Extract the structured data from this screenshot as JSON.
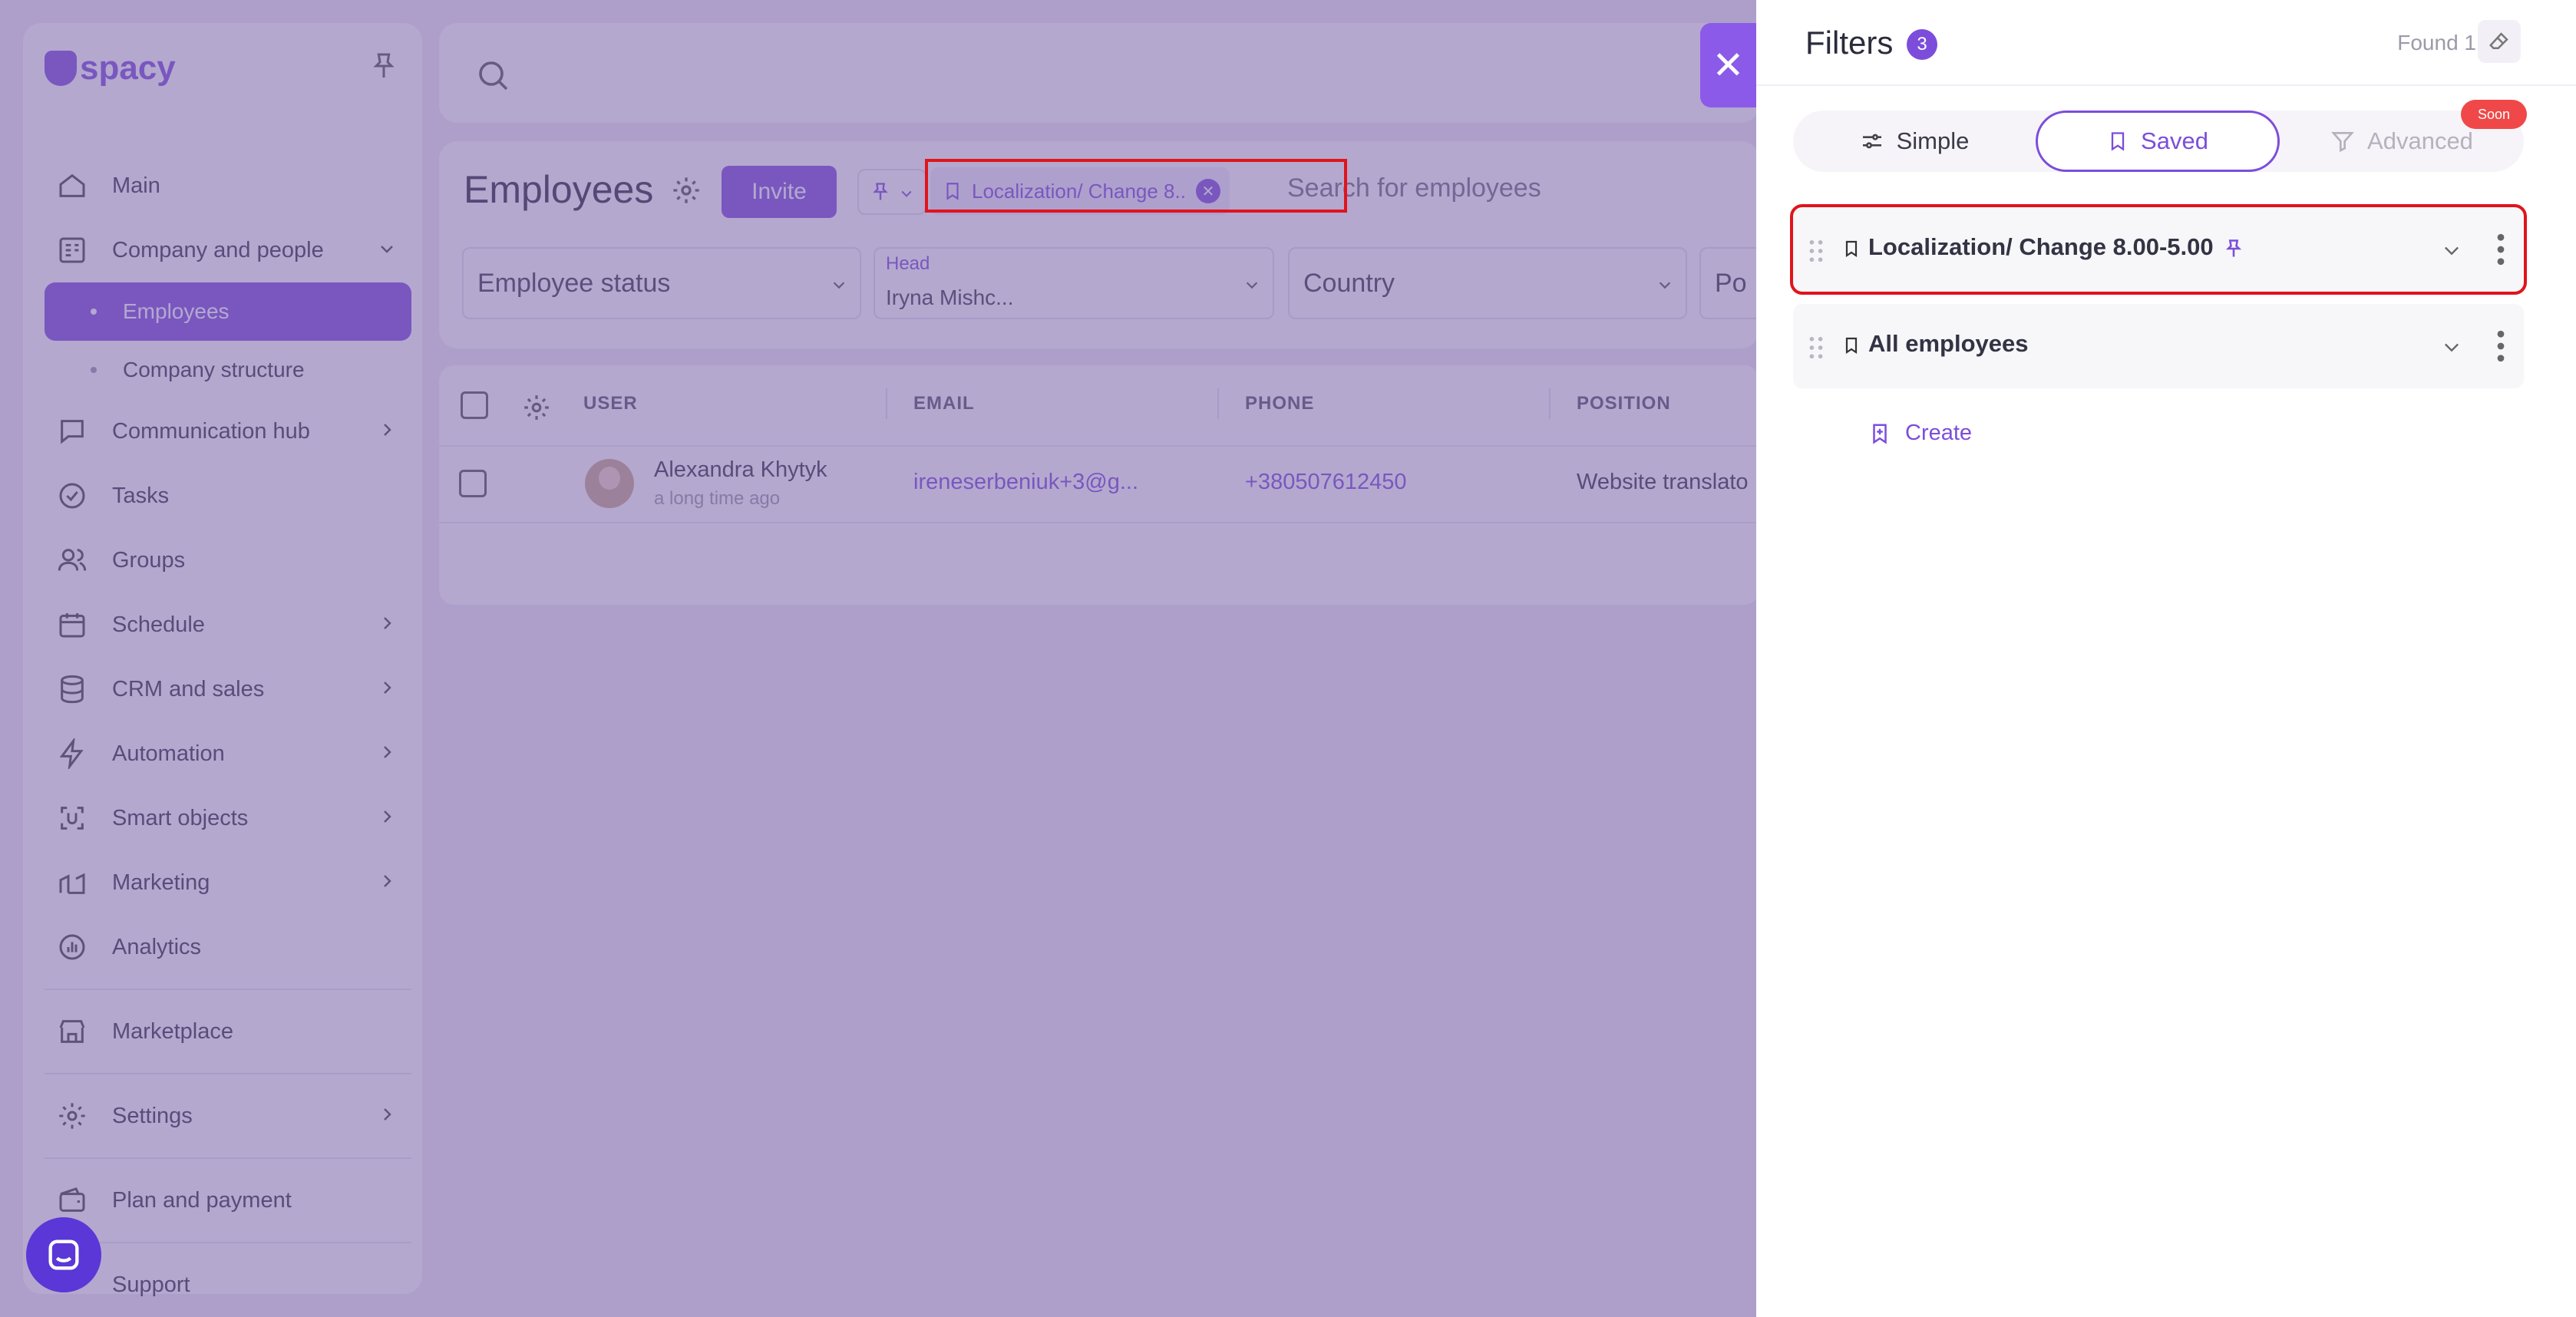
{
  "app": {
    "logo": "spacy"
  },
  "sidebar": {
    "items": [
      {
        "label": "Main",
        "icon": "home-icon"
      },
      {
        "label": "Company and people",
        "icon": "building-icon"
      },
      {
        "label": "Employees",
        "sub": true,
        "active": true
      },
      {
        "label": "Company structure",
        "sub": true
      },
      {
        "label": "Communication hub",
        "icon": "chat-icon"
      },
      {
        "label": "Tasks",
        "icon": "check-circle-icon"
      },
      {
        "label": "Groups",
        "icon": "users-icon"
      },
      {
        "label": "Schedule",
        "icon": "calendar-icon"
      },
      {
        "label": "CRM and sales",
        "icon": "database-icon"
      },
      {
        "label": "Automation",
        "icon": "bolt-icon"
      },
      {
        "label": "Smart objects",
        "icon": "smart-object-icon"
      },
      {
        "label": "Marketing",
        "icon": "marketing-icon"
      },
      {
        "label": "Analytics",
        "icon": "chart-icon"
      },
      {
        "label": "Marketplace",
        "icon": "store-icon"
      },
      {
        "label": "Settings",
        "icon": "gear-icon"
      },
      {
        "label": "Plan and payment",
        "icon": "wallet-icon"
      },
      {
        "label": "Support",
        "icon": "support-icon"
      }
    ]
  },
  "header": {
    "title": "Employees",
    "invite": "Invite",
    "chip": "Localization/ Change 8....",
    "search_placeholder": "Search for employees"
  },
  "filters_bar": {
    "employee_status": "Employee status",
    "head_label": "Head",
    "head_value": "Iryna Mishc...",
    "country": "Country",
    "position_short": "Po"
  },
  "table": {
    "headers": [
      "USER",
      "EMAIL",
      "PHONE",
      "POSITION"
    ],
    "rows": [
      {
        "name": "Alexandra Khytyk",
        "time": "a long time ago",
        "email": "ireneserbeniuk+3@g...",
        "phone": "+380507612450",
        "position": "Website translato"
      }
    ]
  },
  "panel": {
    "title": "Filters",
    "count": "3",
    "found": "Found 1",
    "tabs": {
      "simple": "Simple",
      "saved": "Saved",
      "advanced": "Advanced",
      "soon": "Soon"
    },
    "saved_filters": [
      {
        "name": "Localization/ Change 8.00-5.00",
        "pinned": true
      },
      {
        "name": "All employees",
        "pinned": false
      }
    ],
    "create": "Create"
  },
  "colors": {
    "accent": "#7c4ddb",
    "highlight": "#e0141c",
    "soon": "#f04848"
  }
}
